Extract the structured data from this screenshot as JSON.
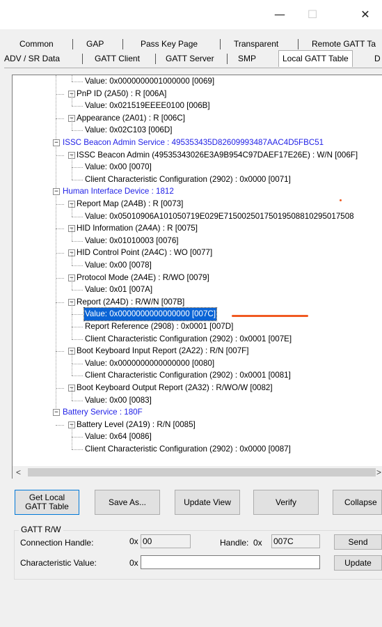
{
  "window": {
    "minimize": "—",
    "maximize": "☐",
    "close": "✕"
  },
  "tabs_row1": [
    "Common",
    "GAP",
    "Pass Key Page",
    "Transparent",
    "Remote GATT Ta"
  ],
  "tabs_row2": [
    "ADV / SR Data",
    "GATT Client",
    "GATT Server",
    "SMP",
    "Local GATT Table",
    "D"
  ],
  "active_tab": "Local GATT Table",
  "tree": [
    {
      "text": "Value: 0x0000000001000000 [0069]"
    },
    {
      "text": "PnP ID (2A50) : R [006A]"
    },
    {
      "text": "Value: 0x021519EEEE0100 [006B]"
    },
    {
      "text": "Appearance (2A01) : R [006C]"
    },
    {
      "text": "Value: 0x02C103 [006D]"
    },
    {
      "text": "ISSC Beacon Admin Service : 495353435D82609993487AAC4D5FBC51"
    },
    {
      "text": "ISSC Beacon Admin (49535343026E3A9B954C97DAEF17E26E) : W/N [006F]"
    },
    {
      "text": "Value: 0x00 [0070]"
    },
    {
      "text": "Client Characteristic Configuration (2902) : 0x0000 [0071]"
    },
    {
      "text": "Human Interface Device : 1812"
    },
    {
      "text": "Report Map (2A4B) : R [0073]"
    },
    {
      "text": "Value: 0x05010906A101050719E029E71500250175019508810295017508"
    },
    {
      "text": "HID Information (2A4A) : R [0075]"
    },
    {
      "text": "Value: 0x01010003 [0076]"
    },
    {
      "text": "HID Control Point (2A4C) : WO [0077]"
    },
    {
      "text": "Value: 0x00 [0078]"
    },
    {
      "text": "Protocol Mode (2A4E) : R/WO [0079]"
    },
    {
      "text": "Value: 0x01 [007A]"
    },
    {
      "text": "Report (2A4D) : R/W/N [007B]"
    },
    {
      "text": "Value: 0x0000000000000000 [007C]"
    },
    {
      "text": "Report Reference (2908) : 0x0001 [007D]"
    },
    {
      "text": "Client Characteristic Configuration (2902) : 0x0001 [007E]"
    },
    {
      "text": "Boot Keyboard Input Report (2A22) : R/N [007F]"
    },
    {
      "text": "Value: 0x0000000000000000 [0080]"
    },
    {
      "text": "Client Characteristic Configuration (2902) : 0x0001 [0081]"
    },
    {
      "text": "Boot Keyboard Output Report (2A32) : R/WO/W [0082]"
    },
    {
      "text": "Value: 0x00 [0083]"
    },
    {
      "text": "Battery Service : 180F"
    },
    {
      "text": "Battery Level (2A19) : R/N [0085]"
    },
    {
      "text": "Value: 0x64 [0086]"
    },
    {
      "text": "Client Characteristic Configuration (2902) : 0x0000 [0087]"
    }
  ],
  "tree_expander_glyph": "−",
  "scroll": {
    "left": "<",
    "right": ">"
  },
  "buttons": {
    "get_local": "Get Local GATT Table",
    "save_as": "Save As...",
    "update_view": "Update View",
    "verify": "Verify",
    "collapse": "Collapse"
  },
  "gatt_rw": {
    "group_label": "GATT R/W",
    "connection_handle_label": "Connection Handle:",
    "prefix_0x": "0x",
    "connection_handle_value": "00",
    "handle_label": "Handle:",
    "handle_value": "007C",
    "characteristic_value_label": "Characteristic Value:",
    "characteristic_value": "",
    "send": "Send",
    "update": "Update"
  },
  "colors": {
    "service_text": "#1f1fe6",
    "selection": "#0a64d6",
    "annotation": "#f05a22"
  }
}
